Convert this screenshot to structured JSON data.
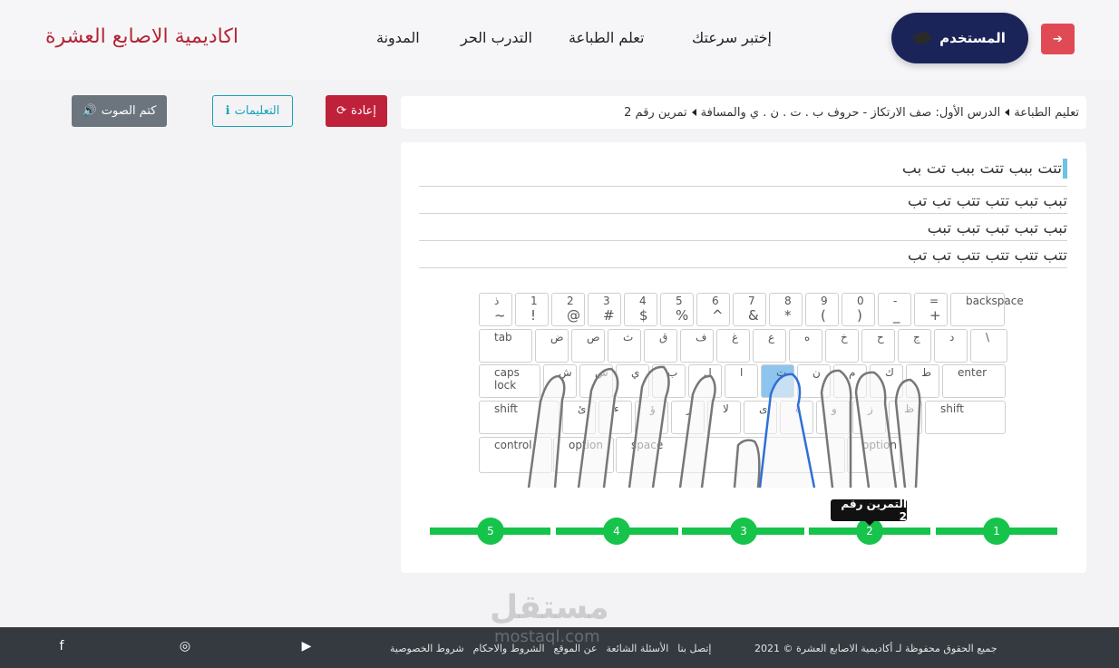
{
  "header": {
    "brand": "اكاديمية الاصابع العشرة",
    "nav": [
      "المدونة",
      "التدرب الحر",
      "تعلم الطباعة",
      "إختبر سرعتك"
    ],
    "user_label": "المستخدم"
  },
  "actions": {
    "mute": "كتم الصوت",
    "instructions": "التعليمات",
    "restart": "إعادة"
  },
  "breadcrumb": [
    "تعليم الطباعة",
    "الدرس الأول: صف الارتكاز - حروف ب . ت . ن . ي والمسافة",
    "تمرين رقم 2"
  ],
  "exercise_lines": [
    "تتت ببب تتت ببب تت بب",
    "تبب تبب تتب تتب تب تب",
    "تبب تبب تبب تبب تبب",
    "تتب تتب تتب تتب تب تب"
  ],
  "keyboard": {
    "row1": [
      [
        "~",
        "ذ"
      ],
      [
        "!",
        "1"
      ],
      [
        "@",
        "2"
      ],
      [
        "#",
        "3"
      ],
      [
        "$",
        "4"
      ],
      [
        "%",
        "5"
      ],
      [
        "^",
        "6"
      ],
      [
        "&",
        "7"
      ],
      [
        "*",
        "8"
      ],
      [
        "(",
        "9"
      ],
      [
        ")",
        "0"
      ],
      [
        "_",
        "-"
      ],
      [
        "+",
        "="
      ],
      [
        "",
        "backspace"
      ]
    ],
    "row2": [
      "tab",
      "ض",
      "ص",
      "ث",
      "ق",
      "ف",
      "غ",
      "ع",
      "ه",
      "خ",
      "ح",
      "ج",
      "د",
      "\\"
    ],
    "row3": [
      "caps lock",
      "ش",
      "س",
      "ي",
      "ب",
      "ل",
      "ا",
      "ت",
      "ن",
      "م",
      "ك",
      "ط",
      "enter"
    ],
    "row4": [
      "shift",
      "ئ",
      "ء",
      "ؤ",
      "ر",
      "لا",
      "ى",
      "ة",
      "و",
      "ز",
      "ظ",
      "shift"
    ],
    "row5": [
      "control",
      "option",
      "space",
      "option"
    ],
    "active_key": "ت"
  },
  "progress": {
    "steps": [
      "1",
      "2",
      "3",
      "4",
      "5"
    ],
    "current": 2,
    "tooltip": "التمرين رقم 2",
    "color": "#16c34b"
  },
  "footer": {
    "copyright": "جميع الحقوق محفوظة لـ أكاديمية الاصابع العشرة © 2021",
    "links": [
      "إتصل بنا",
      "الأسئلة الشائعة",
      "عن الموقع",
      "الشروط والاحكام",
      "شروط الخصوصية"
    ]
  },
  "watermark": {
    "big": "مستقل",
    "small": "mostaql.com"
  }
}
